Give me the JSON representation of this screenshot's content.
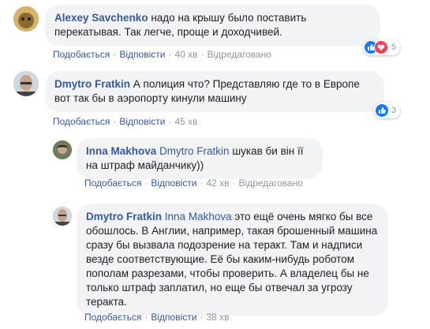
{
  "colors": {
    "author": "#385898",
    "bubble": "#f2f3f5",
    "meta": "#90949c",
    "like": "#1877f2",
    "love": "#f33e58"
  },
  "comments": [
    {
      "author": "Alexey Savchenko",
      "text": "надо на крышу было поставить перекатывая. Так легче, проще и доходчивей.",
      "actions": {
        "like": "Подобається",
        "reply": "Відповісти",
        "time": "40 хв",
        "edited": "Відредаговано"
      },
      "reactions": {
        "count": "5",
        "icons": [
          "like-icon",
          "love-icon"
        ]
      }
    },
    {
      "author": "Dmytro Fratkin",
      "text": "А полиция что? Представляю где то в Европе вот так бы в аэропорту кинули машину",
      "actions": {
        "like": "Подобається",
        "reply": "Відповісти",
        "time": "45 хв"
      },
      "reactions": {
        "count": "3",
        "icons": [
          "like-icon"
        ]
      }
    },
    {
      "author": "Inna Makhova",
      "mention": "Dmytro Fratkin",
      "text": "шукав би він її на штраф майданчику))",
      "actions": {
        "like": "Подобається",
        "reply": "Відповісти",
        "time": "42 хв",
        "edited": "Відредаговано"
      }
    },
    {
      "author": "Dmytro Fratkin",
      "mention": "Inna Makhova",
      "text": "это ещё очень мягко бы все обошлось. В Англии, например, такая брошенный машина сразу бы вызвала подозрение на теракт. Там и надписи везде соответствующие. Её бы каким-нибудь роботом пополам разрезами, чтобы проверить. А владелец бы не только штраф заплатил, но еще бы отвечал за угрозу теракта.",
      "actions": {
        "like": "Подобається",
        "reply": "Відповісти",
        "time": "38 хв"
      }
    }
  ]
}
